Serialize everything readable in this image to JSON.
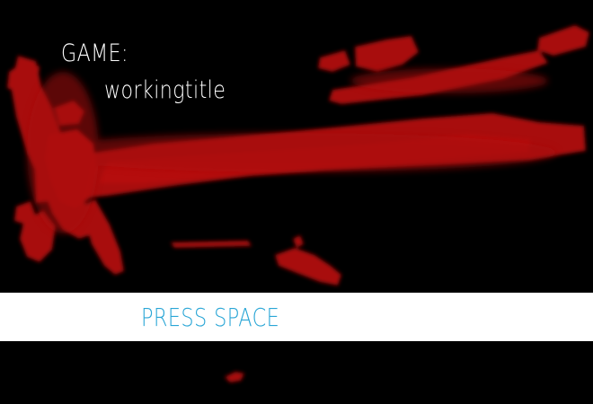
{
  "title": {
    "line1": "GAME:",
    "line2": "workingtitle"
  },
  "prompt": {
    "label": "PRESS SPACE"
  },
  "colors": {
    "background": "#000000",
    "paint": "#a80808",
    "title_text": "#ffffff",
    "prompt_bar": "#ffffff",
    "prompt_text": "#2aa6d6"
  }
}
